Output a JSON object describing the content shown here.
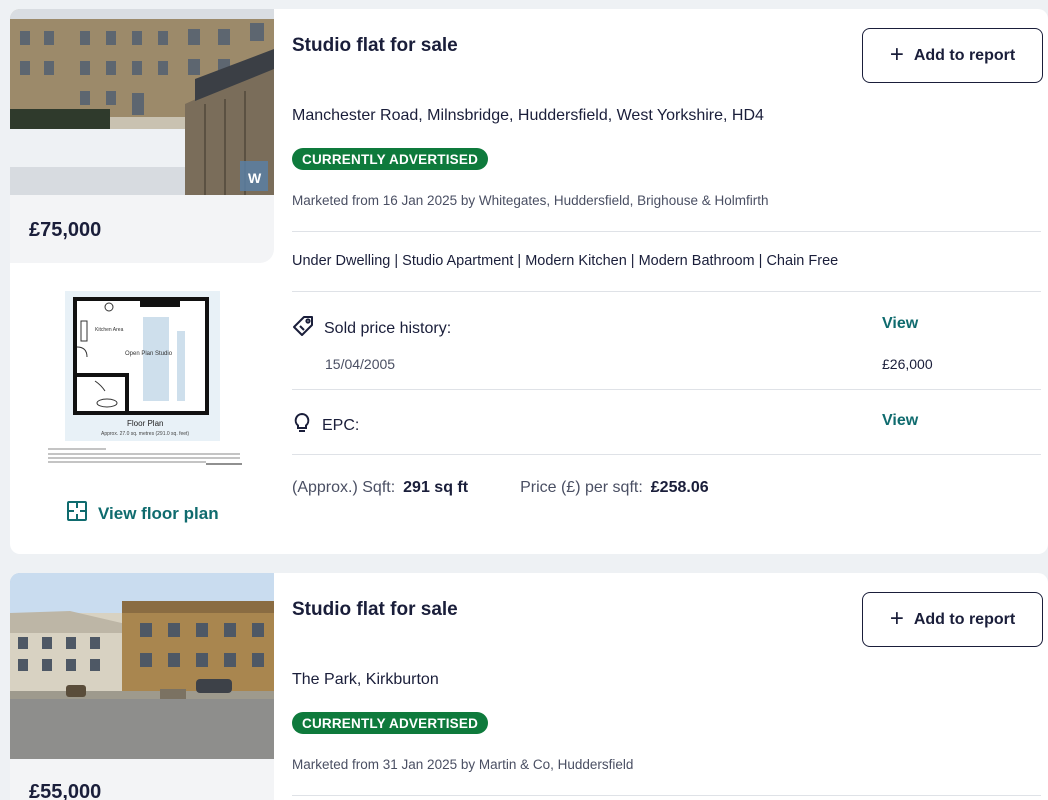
{
  "listings": [
    {
      "price": "£75,000",
      "title": "Studio flat for sale",
      "add_label": "Add to report",
      "address": "Manchester Road, Milnsbridge, Huddersfield, West Yorkshire, HD4",
      "status": "CURRENTLY ADVERTISED",
      "marketed": "Marketed from 16 Jan 2025 by Whitegates, Huddersfield, Brighouse & Holmfirth",
      "features": "Under Dwelling | Studio Apartment | Modern Kitchen | Modern Bathroom | Chain Free",
      "sold_history_label": "Sold price history:",
      "view_label": "View",
      "history": [
        {
          "date": "15/04/2005",
          "price": "£26,000"
        }
      ],
      "epc_label": "EPC:",
      "sqft_label": "(Approx.) Sqft:",
      "sqft_value": "291 sq ft",
      "ppsf_label": "Price (£) per sqft:",
      "ppsf_value": "£258.06",
      "floorplan_link": "View floor plan",
      "floorplan": {
        "kitchen": "Kitchen Area",
        "living": "Open Plan Studio",
        "caption": "Floor Plan",
        "subcaption": "Approx. 27.0 sq. metres (291.0 sq. feet)"
      }
    },
    {
      "price": "£55,000",
      "title": "Studio flat for sale",
      "add_label": "Add to report",
      "address": "The Park, Kirkburton",
      "status": "CURRENTLY ADVERTISED",
      "marketed": "Marketed from 31 Jan 2025 by Martin & Co, Huddersfield"
    }
  ],
  "icons": {
    "plus": "plus-icon",
    "tag": "price-tag-icon",
    "bulb": "lightbulb-icon",
    "floorplan": "floorplan-icon"
  },
  "colors": {
    "accent": "#0f6b6e",
    "badge": "#0e7a3c",
    "text": "#1a1e3a"
  }
}
